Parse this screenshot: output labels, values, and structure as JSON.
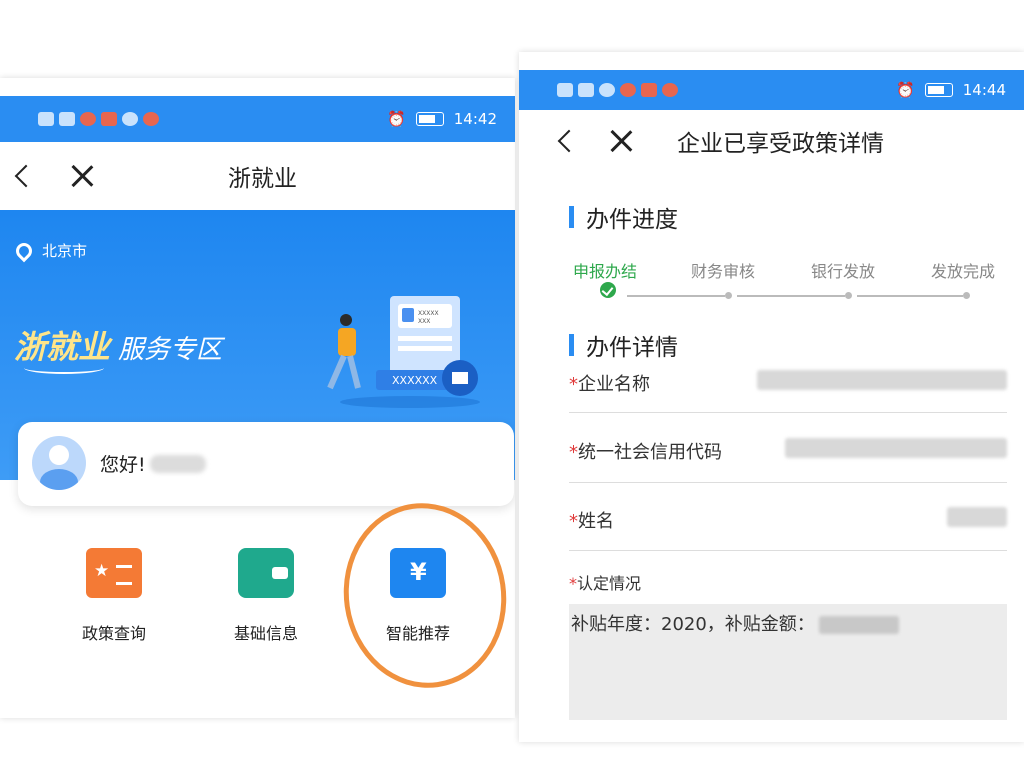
{
  "left_phone": {
    "status_bar": {
      "time": "14:42"
    },
    "nav": {
      "title": "浙就业"
    },
    "banner": {
      "location": "北京市",
      "brand_main": "浙就业",
      "brand_sub": "服务专区",
      "illustration_text": "XXXXXX",
      "illustration_card_top": "XXXXX",
      "illustration_card_bottom": "XXX"
    },
    "greeting": {
      "text": "您好!"
    },
    "services": [
      {
        "label": "政策查询",
        "icon": "policy-book-icon"
      },
      {
        "label": "基础信息",
        "icon": "wallet-icon"
      },
      {
        "label": "智能推荐",
        "icon": "smart-recommend-icon"
      }
    ],
    "annotation_color": "#f0913e"
  },
  "right_phone": {
    "status_bar": {
      "time": "14:44"
    },
    "nav": {
      "title": "企业已享受政策详情"
    },
    "progress": {
      "title": "办件进度",
      "steps": [
        "申报办结",
        "财务审核",
        "银行发放",
        "发放完成"
      ],
      "active_index": 0
    },
    "details": {
      "title": "办件详情",
      "fields": [
        {
          "label": "企业名称"
        },
        {
          "label": "统一社会信用代码"
        },
        {
          "label": "姓名"
        }
      ],
      "recognition_label": "认定情况",
      "recognition_text": "补贴年度：2020，补贴金额："
    }
  },
  "colors": {
    "primary": "#2a8df2",
    "success": "#2ea84c",
    "required": "#e03b3b"
  }
}
